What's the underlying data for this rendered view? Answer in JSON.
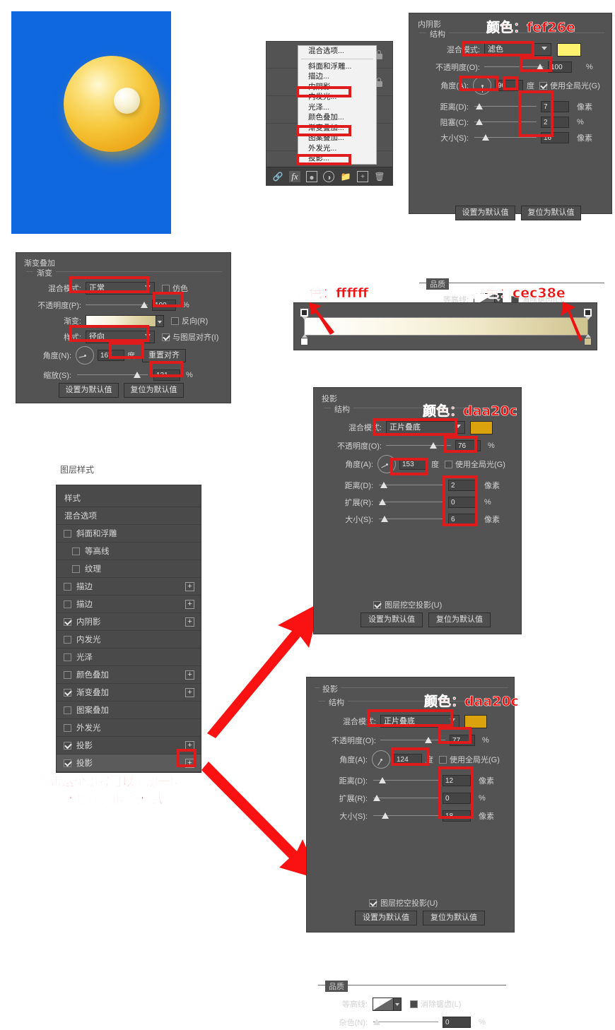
{
  "artwork": {
    "background_color": "#1068e0",
    "sphere_colors": [
      "#fff6c8",
      "#f7c93f",
      "#e8a019",
      "#f0b0a0"
    ],
    "pearl_colors": [
      "#ffffff",
      "#f5eed0",
      "#d8cda0"
    ]
  },
  "layers_context_menu": {
    "items": [
      "混合选项...",
      "斜面和浮雕...",
      "描边...",
      "内阴影...",
      "内发光...",
      "光泽...",
      "颜色叠加...",
      "渐变叠加...",
      "图案叠加...",
      "外发光...",
      "投影..."
    ],
    "highlighted": [
      "内阴影...",
      "渐变叠加...",
      "投影..."
    ],
    "toolbar_icons": [
      "link-icon",
      "fx-icon",
      "mask-icon",
      "adjustment-icon",
      "folder-icon",
      "new-layer-icon",
      "trash-icon"
    ],
    "lock_icon": "lock-icon"
  },
  "inner_shadow": {
    "title": "内阴影",
    "section_structure": "结构",
    "section_quality": "品质",
    "color_note": "颜色：fef26e",
    "color_hex": "#fef26e",
    "blend_mode_label": "混合模式:",
    "blend_mode_value": "滤色",
    "opacity_label": "不透明度(O):",
    "opacity_value": "100",
    "opacity_unit": "%",
    "angle_label": "角度(A):",
    "angle_value": "90",
    "angle_unit": "度",
    "global_light_label": "使用全局光(G)",
    "global_light_checked": true,
    "distance_label": "距离(D):",
    "distance_value": "7",
    "distance_unit": "像素",
    "choke_label": "阻塞(C):",
    "choke_value": "2",
    "choke_unit": "%",
    "size_label": "大小(S):",
    "size_value": "16",
    "size_unit": "像素",
    "contour_label": "等高线:",
    "antialias_label": "消除锯齿(L)",
    "antialias_checked": false,
    "noise_label": "杂色(N):",
    "noise_value": "0",
    "noise_unit": "%",
    "set_default_btn": "设置为默认值",
    "reset_default_btn": "复位为默认值"
  },
  "gradient_overlay": {
    "title": "渐变叠加",
    "section_gradient": "渐变",
    "blend_mode_label": "混合模式:",
    "blend_mode_value": "正常",
    "dither_label": "仿色",
    "dither_checked": false,
    "opacity_label": "不透明度(P):",
    "opacity_value": "100",
    "opacity_unit": "%",
    "gradient_label": "渐变:",
    "reverse_label": "反向(R)",
    "reverse_checked": false,
    "style_label": "样式:",
    "style_value": "径向",
    "align_label": "与图层对齐(I)",
    "align_checked": true,
    "angle_label": "角度(N):",
    "angle_value": "167",
    "angle_unit": "度",
    "reset_align_btn": "重置对齐",
    "scale_label": "缩放(S):",
    "scale_value": "121",
    "scale_unit": "%",
    "set_default_btn": "设置为默认值",
    "reset_default_btn": "复位为默认值"
  },
  "gradient_editor": {
    "left_color_note": "颜色：ffffff",
    "right_color_note": "颜色：cec38e",
    "left_color_hex": "#ffffff",
    "right_color_hex": "#cec38e"
  },
  "layer_styles": {
    "title": "图层样式",
    "header": "样式",
    "blend_options": "混合选项",
    "items": [
      {
        "label": "斜面和浮雕",
        "checked": false,
        "plus": false,
        "indent": 0
      },
      {
        "label": "等高线",
        "checked": false,
        "plus": false,
        "indent": 1
      },
      {
        "label": "纹理",
        "checked": false,
        "plus": false,
        "indent": 1
      },
      {
        "label": "描边",
        "checked": false,
        "plus": true,
        "indent": 0
      },
      {
        "label": "描边",
        "checked": false,
        "plus": true,
        "indent": 0
      },
      {
        "label": "内阴影",
        "checked": true,
        "plus": true,
        "indent": 0
      },
      {
        "label": "内发光",
        "checked": false,
        "plus": false,
        "indent": 0
      },
      {
        "label": "光泽",
        "checked": false,
        "plus": false,
        "indent": 0
      },
      {
        "label": "颜色叠加",
        "checked": false,
        "plus": true,
        "indent": 0
      },
      {
        "label": "渐变叠加",
        "checked": true,
        "plus": true,
        "indent": 0
      },
      {
        "label": "图案叠加",
        "checked": false,
        "plus": false,
        "indent": 0
      },
      {
        "label": "外发光",
        "checked": false,
        "plus": false,
        "indent": 0
      },
      {
        "label": "投影",
        "checked": true,
        "plus": true,
        "indent": 0
      },
      {
        "label": "投影",
        "checked": true,
        "plus": true,
        "indent": 0,
        "selected": true
      }
    ],
    "plus_symbol": "+",
    "annotation_line1": "点击这个加号可以增加一层",
    "annotation_line2": "相同的图层的样式"
  },
  "drop_shadow_1": {
    "title": "投影",
    "section_structure": "结构",
    "section_quality": "品质",
    "color_note": "颜色：daa20c",
    "color_hex": "#daa20c",
    "blend_mode_label": "混合模式:",
    "blend_mode_value": "正片叠底",
    "opacity_label": "不透明度(O):",
    "opacity_value": "76",
    "opacity_unit": "%",
    "angle_label": "角度(A):",
    "angle_value": "153",
    "angle_unit": "度",
    "global_light_label": "使用全局光(G)",
    "global_light_checked": false,
    "distance_label": "距离(D):",
    "distance_value": "2",
    "distance_unit": "像素",
    "spread_label": "扩展(R):",
    "spread_value": "0",
    "spread_unit": "%",
    "size_label": "大小(S):",
    "size_value": "6",
    "size_unit": "像素",
    "contour_label": "等高线:",
    "antialias_label": "消除锯齿(L)",
    "antialias_checked": false,
    "noise_label": "杂色(N):",
    "noise_value": "0",
    "noise_unit": "%",
    "knockout_label": "图层挖空投影(U)",
    "knockout_checked": true,
    "set_default_btn": "设置为默认值",
    "reset_default_btn": "复位为默认值"
  },
  "drop_shadow_2": {
    "title": "投影",
    "section_structure": "结构",
    "section_quality": "品质",
    "color_note": "颜色：daa20c",
    "color_hex": "#daa20c",
    "blend_mode_label": "混合模式:",
    "blend_mode_value": "正片叠底",
    "opacity_label": "不透明度(O):",
    "opacity_value": "77",
    "opacity_unit": "%",
    "angle_label": "角度(A):",
    "angle_value": "124",
    "angle_unit": "度",
    "global_light_label": "使用全局光(G)",
    "global_light_checked": false,
    "distance_label": "距离(D):",
    "distance_value": "12",
    "distance_unit": "像素",
    "spread_label": "扩展(R):",
    "spread_value": "0",
    "spread_unit": "%",
    "size_label": "大小(S):",
    "size_value": "18",
    "size_unit": "像素",
    "contour_label": "等高线:",
    "antialias_label": "消除锯齿(L)",
    "antialias_checked": false,
    "noise_label": "杂色(N):",
    "noise_value": "0",
    "noise_unit": "%",
    "knockout_label": "图层挖空投影(U)",
    "knockout_checked": true,
    "set_default_btn": "设置为默认值",
    "reset_default_btn": "复位为默认值"
  },
  "annotation_color": "#ee1111"
}
